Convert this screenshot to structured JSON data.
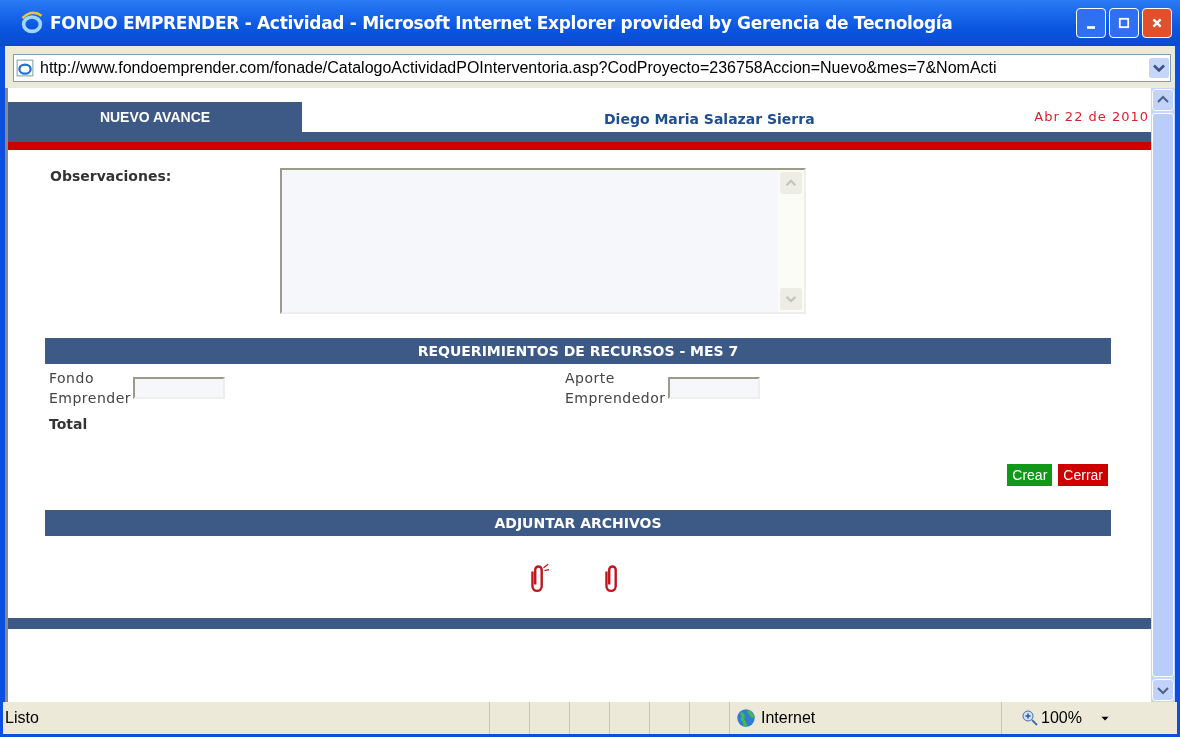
{
  "window": {
    "title": "FONDO EMPRENDER - Actividad - Microsoft Internet Explorer provided by Gerencia de Tecnología"
  },
  "address": {
    "url": "http://www.fondoemprender.com/fonade/CatalogoActividadPOInterventoria.asp?CodProyecto=236758Accion=Nuevo&mes=7&NomActi"
  },
  "header": {
    "tab": "NUEVO AVANCE",
    "user": "Diego Maria Salazar Sierra",
    "date": "Abr 22 de 2010"
  },
  "observaciones": {
    "label": "Observaciones:"
  },
  "recursos": {
    "title": "REQUERIMIENTOS DE RECURSOS - MES 7",
    "fields": [
      {
        "label_lines": [
          "Fondo",
          "Emprender"
        ]
      },
      {
        "label_lines": [
          "Aporte",
          "Emprendedor"
        ]
      }
    ],
    "total": "Total"
  },
  "buttons": [
    {
      "label": "Crear",
      "kind": "primary"
    },
    {
      "label": "Cerrar",
      "kind": "danger"
    }
  ],
  "adjuntar": {
    "title": "ADJUNTAR ARCHIVOS"
  },
  "status_bar": {
    "text": "Listo",
    "zone": "Internet",
    "zoom": "100%"
  }
}
